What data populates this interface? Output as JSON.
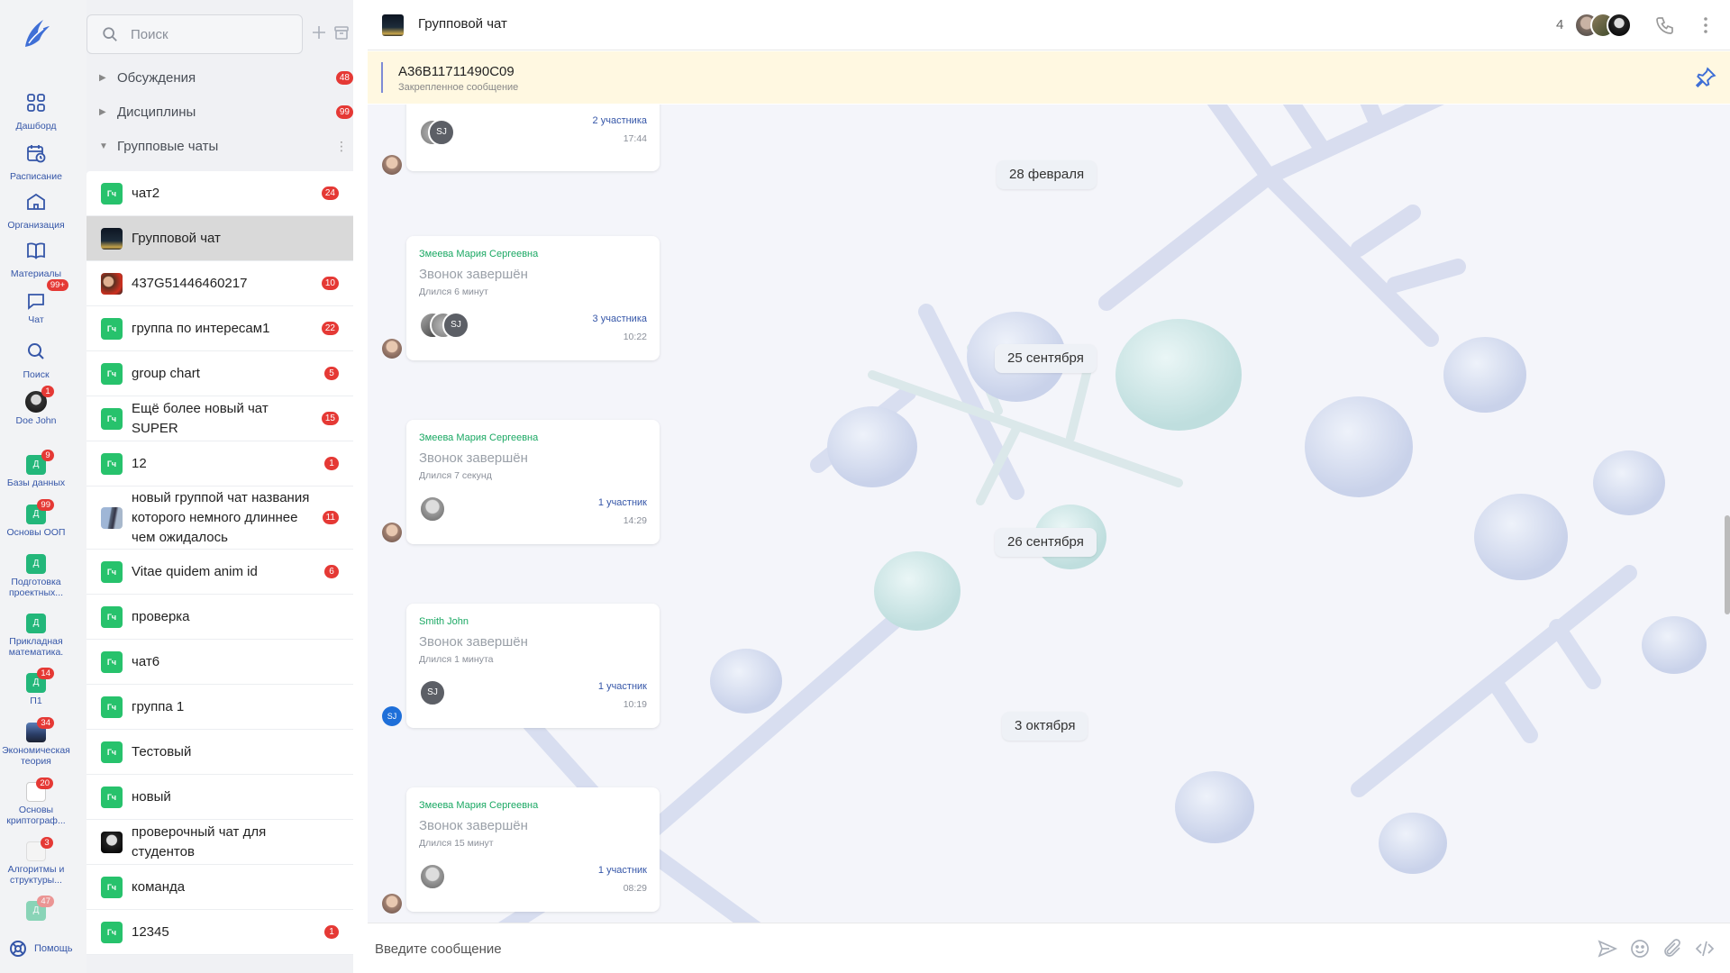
{
  "rail": {
    "items": [
      {
        "label": "Дашборд",
        "icon": "grid-icon"
      },
      {
        "label": "Расписание",
        "icon": "calendar-clock-icon"
      },
      {
        "label": "Организация",
        "icon": "building-icon"
      },
      {
        "label": "Материалы",
        "icon": "book-icon"
      },
      {
        "label": "Чат",
        "icon": "chat-bubble-icon",
        "badge": "99+"
      },
      {
        "label": "Поиск",
        "icon": "search-icon"
      },
      {
        "label": "Doe John",
        "icon": "user-avatar",
        "badge": "1"
      }
    ],
    "courses": [
      {
        "label": "Базы данных",
        "letter": "Д",
        "badge": "9"
      },
      {
        "label": "Основы ООП",
        "letter": "Д",
        "badge": "99"
      },
      {
        "label": "Подготовка проектных...",
        "letter": "Д",
        "badge": ""
      },
      {
        "label": "Прикладная математика.",
        "letter": "Д",
        "badge": ""
      },
      {
        "label": "П1",
        "letter": "Д",
        "badge": "14"
      },
      {
        "label": "Экономическая теория",
        "letter": "",
        "badge": "34"
      },
      {
        "label": "Основы криптограф...",
        "letter": "",
        "badge": "20"
      },
      {
        "label": "Алгоритмы и структуры...",
        "letter": "",
        "badge": "3"
      },
      {
        "label": "",
        "letter": "Д",
        "badge": "47"
      }
    ],
    "help_label": "Помощь"
  },
  "panel": {
    "search_placeholder": "Поиск",
    "sections": [
      {
        "label": "Обсуждения",
        "badge": "48",
        "expanded": false
      },
      {
        "label": "Дисциплины",
        "badge": "99",
        "expanded": false
      },
      {
        "label": "Групповые чаты",
        "badge": "",
        "expanded": true
      }
    ],
    "avatar_letters": "Гч",
    "chats": [
      {
        "name": "чат2",
        "badge": "24",
        "avatar": "gc",
        "active": false
      },
      {
        "name": "Групповой чат",
        "badge": "",
        "avatar": "night",
        "active": true
      },
      {
        "name": "437G51446460217",
        "badge": "10",
        "avatar": "photo",
        "active": false
      },
      {
        "name": "группа по интересам1",
        "badge": "22",
        "avatar": "gc",
        "active": false
      },
      {
        "name": "group chart",
        "badge": "5",
        "avatar": "gc",
        "active": false
      },
      {
        "name": "Ещё более новый чат SUPER",
        "badge": "15",
        "avatar": "gc",
        "active": false
      },
      {
        "name": "12",
        "badge": "1",
        "avatar": "gc",
        "active": false
      },
      {
        "name": "новый группой чат названия которого немного длиннее чем ожидалось",
        "badge": "11",
        "avatar": "tower",
        "active": false
      },
      {
        "name": "Vitae quidem anim id",
        "badge": "6",
        "avatar": "gc",
        "active": false
      },
      {
        "name": "проверка",
        "badge": "",
        "avatar": "gc",
        "active": false
      },
      {
        "name": "чат6",
        "badge": "",
        "avatar": "gc",
        "active": false
      },
      {
        "name": "группа 1",
        "badge": "",
        "avatar": "gc",
        "active": false
      },
      {
        "name": "Тестовый",
        "badge": "",
        "avatar": "gc",
        "active": false
      },
      {
        "name": "новый",
        "badge": "",
        "avatar": "gc",
        "active": false
      },
      {
        "name": "проверочный чат для студентов",
        "badge": "",
        "avatar": "alien",
        "active": false
      },
      {
        "name": "команда",
        "badge": "",
        "avatar": "gc",
        "active": false
      },
      {
        "name": "12345",
        "badge": "1",
        "avatar": "gc",
        "active": false
      }
    ]
  },
  "header": {
    "title": "Групповой чат",
    "member_count": "4"
  },
  "pinned": {
    "text": "A36B11711490C09",
    "label": "Закрепленное сообщение"
  },
  "messages": {
    "first": {
      "participants": "2 участника",
      "time": "17:44",
      "avatar_initials": "SJ"
    },
    "dates": [
      "28 февраля",
      "25 сентября",
      "26 сентября",
      "3 октября"
    ],
    "calls": [
      {
        "author": "Змеева Мария Сергеевна",
        "title": "Звонок завершён",
        "duration": "Длился 6 минут",
        "participants": "3 участника",
        "time": "10:22",
        "initials": "SJ"
      },
      {
        "author": "Змеева Мария Сергеевна",
        "title": "Звонок завершён",
        "duration": "Длился 7 секунд",
        "participants": "1 участник",
        "time": "14:29",
        "initials": ""
      },
      {
        "author": "Smith John",
        "title": "Звонок завершён",
        "duration": "Длился 1 минута",
        "participants": "1 участник",
        "time": "10:19",
        "initials": "SJ"
      },
      {
        "author": "Змеева Мария Сергеевна",
        "title": "Звонок завершён",
        "duration": "Длился 15 минут",
        "participants": "1 участник",
        "time": "08:29",
        "initials": ""
      }
    ],
    "sender_initials": "SJ"
  },
  "composer": {
    "placeholder": "Введите сообщение"
  },
  "colors": {
    "accent": "#3556a8",
    "badge": "#e53935",
    "chat_green": "#27c26c",
    "pinned_bg": "#fff8e1"
  }
}
